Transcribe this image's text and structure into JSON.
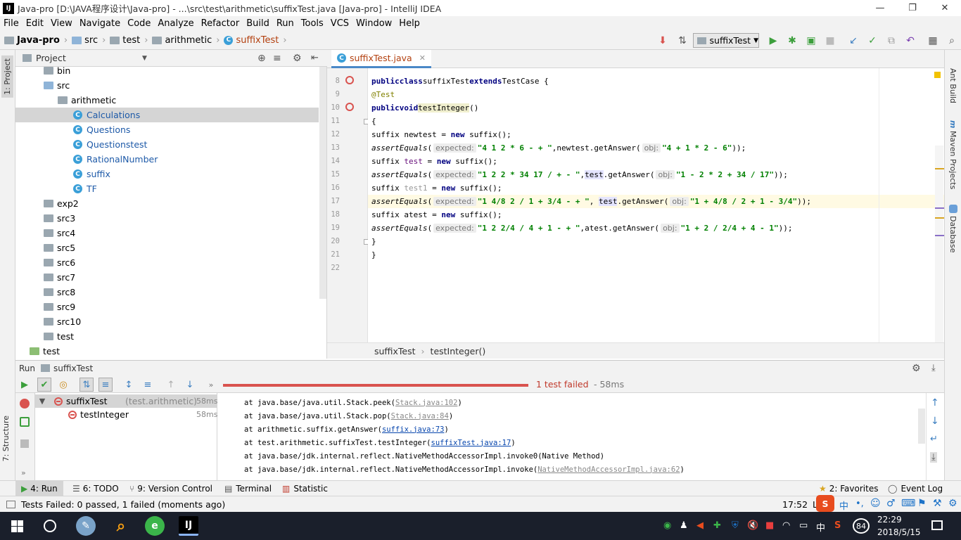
{
  "window": {
    "title": "Java-pro [D:\\JAVA程序设计\\Java-pro] - ...\\src\\test\\arithmetic\\suffixTest.java [Java-pro] - IntelliJ IDEA",
    "minimize": "—",
    "restore": "❐",
    "close": "✕"
  },
  "menu": [
    "File",
    "Edit",
    "View",
    "Navigate",
    "Code",
    "Analyze",
    "Refactor",
    "Build",
    "Run",
    "Tools",
    "VCS",
    "Window",
    "Help"
  ],
  "breadcrumb": [
    "Java-pro",
    "src",
    "test",
    "arithmetic",
    "suffixTest"
  ],
  "run_config": "suffixTest",
  "left_tabs": {
    "project": "1: Project",
    "structure": "7: Structure"
  },
  "right_tabs": {
    "ant": "Ant Build",
    "maven": "Maven Projects",
    "database": "Database"
  },
  "project_panel": {
    "title": "Project"
  },
  "tree": [
    {
      "label": "bin",
      "type": "folder",
      "depth": 1,
      "arrow": "right"
    },
    {
      "label": "src",
      "type": "src",
      "depth": 1,
      "arrow": "down"
    },
    {
      "label": "arithmetic",
      "type": "folder",
      "depth": 2,
      "arrow": "down"
    },
    {
      "label": "Calculations",
      "type": "class",
      "depth": 3,
      "arrow": "",
      "selected": true
    },
    {
      "label": "Questions",
      "type": "class",
      "depth": 3,
      "arrow": ""
    },
    {
      "label": "Questionstest",
      "type": "class",
      "depth": 3,
      "arrow": ""
    },
    {
      "label": "RationalNumber",
      "type": "class",
      "depth": 3,
      "arrow": ""
    },
    {
      "label": "suffix",
      "type": "class",
      "depth": 3,
      "arrow": ""
    },
    {
      "label": "TF",
      "type": "class",
      "depth": 3,
      "arrow": ""
    },
    {
      "label": "exp2",
      "type": "folder",
      "depth": 1,
      "arrow": "right"
    },
    {
      "label": "src3",
      "type": "folder",
      "depth": 1,
      "arrow": "right"
    },
    {
      "label": "src4",
      "type": "folder",
      "depth": 1,
      "arrow": "right"
    },
    {
      "label": "src5",
      "type": "folder",
      "depth": 1,
      "arrow": "right"
    },
    {
      "label": "src6",
      "type": "folder",
      "depth": 1,
      "arrow": "right"
    },
    {
      "label": "src7",
      "type": "folder",
      "depth": 1,
      "arrow": "right"
    },
    {
      "label": "src8",
      "type": "folder",
      "depth": 1,
      "arrow": "right"
    },
    {
      "label": "src9",
      "type": "folder",
      "depth": 1,
      "arrow": "right"
    },
    {
      "label": "src10",
      "type": "folder",
      "depth": 1,
      "arrow": "right"
    },
    {
      "label": "test",
      "type": "folder",
      "depth": 1,
      "arrow": "right"
    },
    {
      "label": "test",
      "type": "test",
      "depth": 0,
      "arrow": "down"
    }
  ],
  "editor": {
    "tab": "suffixTest.java",
    "line_numbers": [
      "8",
      "9",
      "10",
      "11",
      "12",
      "13",
      "14",
      "15",
      "16",
      "17",
      "18",
      "19",
      "20",
      "21",
      "22"
    ],
    "code": {
      "l8": {
        "kw1": "public",
        "kw2": "class",
        "name": "suffixTest",
        "kw3": "extends",
        "base": "TestCase {"
      },
      "l9": {
        "ann": "@Test"
      },
      "l10": {
        "kw1": "public",
        "kw2": "void",
        "meth": "testInteger",
        "rest": "()"
      },
      "l11": {
        "t": "{"
      },
      "l12": {
        "a": "suffix newtest = ",
        "kw": "new",
        "b": " suffix();"
      },
      "l13": {
        "fn": "assertEquals",
        "p": "(",
        "h1": "expected:",
        "s1": "\"4 1 2 * 6 - + \"",
        "m": ",newtest.getAnswer(",
        "h2": "obj:",
        "s2": "\"4 + 1 * 2 - 6\"",
        "e": "));"
      },
      "l14": {
        "a": "suffix ",
        "v": "test",
        "b": " = ",
        "kw": "new",
        "c": " suffix();"
      },
      "l15": {
        "fn": "assertEquals",
        "p": "(",
        "h1": "expected:",
        "s1": "\"1 2 2 * 34 17 / + - \"",
        "c": ",",
        "v": "test",
        "m": ".getAnswer(",
        "h2": "obj:",
        "s2": "\"1 - 2 * 2 + 34 / 17\"",
        "e": "));"
      },
      "l16": {
        "a": "suffix ",
        "v": "test1",
        "b": " = ",
        "kw": "new",
        "c": " suffix();"
      },
      "l17": {
        "fn": "assertEquals",
        "p": "(",
        "h1": "expected:",
        "s1": "\"1 4/8 2 / 1 + 3/4 - + \"",
        "c": ", ",
        "v": "test",
        "m": ".getAnswer(",
        "h2": "obj:",
        "s2": "\"1 + 4/8 / 2 + 1 - 3/4\"",
        "e": "));"
      },
      "l18": {
        "a": "suffix atest = ",
        "kw": "new",
        "b": " suffix();"
      },
      "l19": {
        "fn": "assertEquals",
        "p": "(",
        "h1": "expected:",
        "s1": "\"1 2 2/4 / 4 + 1 - + \"",
        "m": ",atest.getAnswer(",
        "h2": "obj:",
        "s2": "\"1 + 2 / 2/4 + 4 - 1\"",
        "e": "));"
      },
      "l20": {
        "t": "}"
      },
      "l21": {
        "t": "}"
      }
    },
    "breadcrumb": [
      "suffixTest",
      "testInteger()"
    ]
  },
  "run": {
    "header_label": "Run",
    "config": "suffixTest",
    "status": "1 test failed",
    "duration": "- 58ms",
    "tree": [
      {
        "name": "suffixTest",
        "pkg": "(test.arithmetic)",
        "time": "58ms"
      },
      {
        "name": "testInteger",
        "time": "58ms"
      }
    ],
    "console": [
      {
        "pre": "at java.base/java.util.Stack.peek(",
        "link": "Stack.java:102",
        "post": ")",
        "style": "grey"
      },
      {
        "pre": "at java.base/java.util.Stack.pop(",
        "link": "Stack.java:84",
        "post": ")",
        "style": "grey"
      },
      {
        "pre": "at arithmetic.suffix.getAnswer(",
        "link": "suffix.java:73",
        "post": ")",
        "style": "blue"
      },
      {
        "pre": "at test.arithmetic.suffixTest.testInteger(",
        "link": "suffixTest.java:17",
        "post": ")",
        "style": "blue"
      },
      {
        "pre": "at java.base/jdk.internal.reflect.NativeMethodAccessorImpl.invoke0(Native Method)",
        "link": "",
        "post": "",
        "style": "none"
      },
      {
        "pre": "at java.base/jdk.internal.reflect.NativeMethodAccessorImpl.invoke(",
        "link": "NativeMethodAccessorImpl.java:62",
        "post": ")",
        "style": "grey"
      }
    ]
  },
  "bottom_tabs": {
    "run": "4: Run",
    "todo": "6: TODO",
    "vcs": "9: Version Control",
    "terminal": "Terminal",
    "statistic": "Statistic",
    "favorites": "2: Favorites",
    "eventlog": "Event Log"
  },
  "status": {
    "message": "Tests Failed: 0 passed, 1 failed (moments ago)",
    "position": "17:52",
    "lf": "LF"
  },
  "taskbar": {
    "time": "22:29",
    "date": "2018/5/15",
    "ime": "中",
    "badge": "84"
  }
}
